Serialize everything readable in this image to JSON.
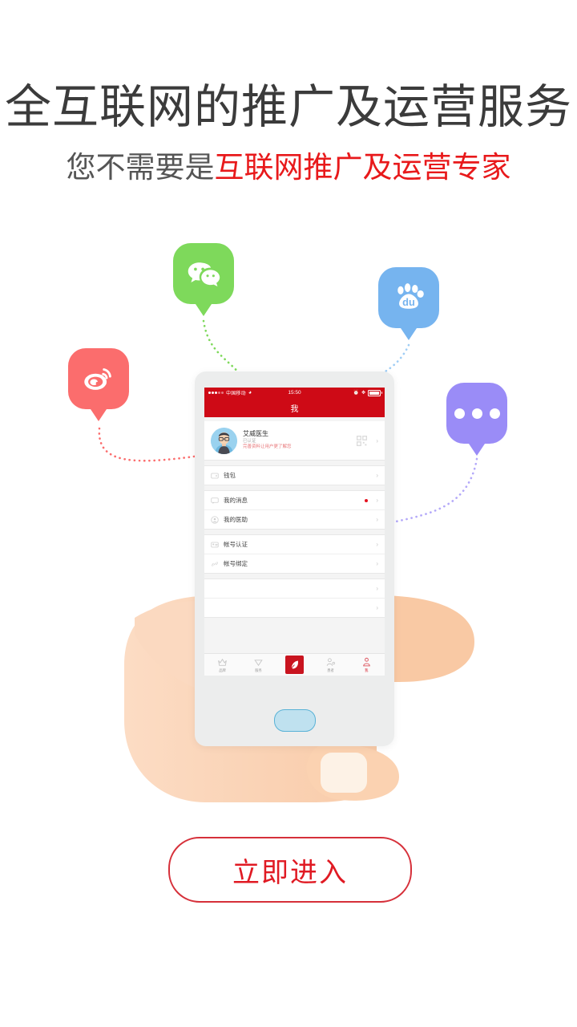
{
  "promo": {
    "headline": "全互联网的推广及运营服务",
    "subline_prefix": "您不需要是",
    "subline_accent": "互联网推广及运营专家",
    "cta_label": "立即进入",
    "accent_color": "#e01a23"
  },
  "bubbles": [
    {
      "name": "weibo",
      "icon": "weibo-icon",
      "color": "#fb6d6d"
    },
    {
      "name": "wechat",
      "icon": "wechat-icon",
      "color": "#7ed95b"
    },
    {
      "name": "baidu",
      "icon": "baidu-icon",
      "label": "du",
      "color": "#76b4ef"
    },
    {
      "name": "more",
      "icon": "ellipsis-icon",
      "color": "#9a8cf7"
    }
  ],
  "phone": {
    "statusbar": {
      "carrier": "中国移动",
      "time": "15:50",
      "wifi_icon": "wifi-icon",
      "alarm_icon": "alarm-icon",
      "bluetooth_icon": "bluetooth-icon",
      "battery_icon": "battery-icon"
    },
    "navbar": {
      "title": "我",
      "bg": "#ce0a16"
    },
    "profile": {
      "name": "艾威医生",
      "verified": "已认证",
      "tip": "完善资料让用户更了解您",
      "qr_icon": "qrcode-icon",
      "chevron_icon": "chevron-right-icon"
    },
    "menu_groups": [
      {
        "rows": [
          {
            "icon": "wallet-icon",
            "label": "钱包",
            "badge": false
          }
        ]
      },
      {
        "rows": [
          {
            "icon": "message-icon",
            "label": "我的消息",
            "badge": true
          },
          {
            "icon": "assistant-icon",
            "label": "我的医助",
            "badge": false
          }
        ]
      },
      {
        "rows": [
          {
            "icon": "id-card-icon",
            "label": "帐号认证",
            "badge": false
          },
          {
            "icon": "link-icon",
            "label": "帐号绑定",
            "badge": false
          }
        ]
      },
      {
        "rows": [
          {
            "icon": "blank-icon",
            "label": "",
            "badge": false
          },
          {
            "icon": "blank-icon",
            "label": "",
            "badge": false
          }
        ]
      }
    ],
    "tabs": [
      {
        "icon": "crown-icon",
        "label": "品牌",
        "active": false
      },
      {
        "icon": "heart-icon",
        "label": "服务",
        "active": false
      },
      {
        "icon": "feather-icon",
        "label": "",
        "active": false,
        "center": true
      },
      {
        "icon": "patient-icon",
        "label": "患者",
        "active": false
      },
      {
        "icon": "user-icon",
        "label": "我",
        "active": true
      }
    ],
    "home_button": "home-button"
  }
}
